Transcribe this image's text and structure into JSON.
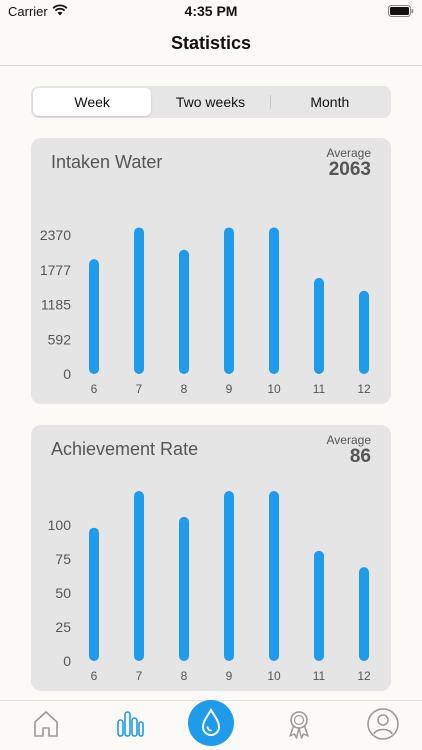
{
  "status_bar": {
    "carrier": "Carrier",
    "time": "4:35 PM"
  },
  "nav": {
    "title": "Statistics"
  },
  "segmented": {
    "options": [
      "Week",
      "Two weeks",
      "Month"
    ],
    "selected": "Week"
  },
  "cards": [
    {
      "title": "Intaken Water",
      "average_label": "Average",
      "average_value": "2063"
    },
    {
      "title": "Achievement Rate",
      "average_label": "Average",
      "average_value": "86"
    }
  ],
  "chart_data": [
    {
      "type": "bar",
      "title": "Intaken Water",
      "categories": [
        "6",
        "7",
        "8",
        "9",
        "10",
        "11",
        "12"
      ],
      "values": [
        1960,
        2500,
        2120,
        2500,
        2500,
        1640,
        1420
      ],
      "yticks": [
        "0",
        "592",
        "1185",
        "1777",
        "2370"
      ],
      "ytick_values": [
        0,
        592,
        1185,
        1777,
        2370
      ],
      "ylim": [
        0,
        2900
      ],
      "color": "#1f9bec",
      "grid": false
    },
    {
      "type": "bar",
      "title": "Achievement Rate",
      "categories": [
        "6",
        "7",
        "8",
        "9",
        "10",
        "11",
        "12"
      ],
      "values": [
        98,
        125,
        106,
        125,
        125,
        81,
        69
      ],
      "yticks": [
        "0",
        "25",
        "50",
        "75",
        "100"
      ],
      "ytick_values": [
        0,
        25,
        50,
        75,
        100
      ],
      "ylim": [
        0,
        125
      ],
      "color": "#1f9bec",
      "grid": false
    }
  ],
  "tab_bar": {
    "items": [
      "home-icon",
      "statistics-icon",
      "water-drop-icon",
      "award-icon",
      "profile-icon"
    ],
    "active_color": "#1f9bec",
    "inactive_color": "#9a9a9a"
  }
}
